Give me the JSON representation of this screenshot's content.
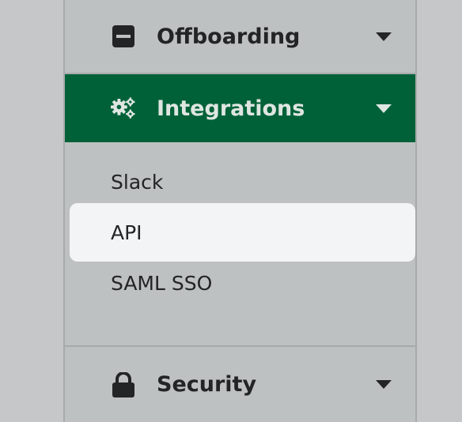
{
  "sidebar": {
    "sections": {
      "offboarding": {
        "label": "Offboarding",
        "icon": "minus-square-icon"
      },
      "integrations": {
        "label": "Integrations",
        "icon": "gears-icon",
        "items": [
          {
            "label": "Slack",
            "active": false
          },
          {
            "label": "API",
            "active": true
          },
          {
            "label": "SAML SSO",
            "active": false
          }
        ]
      },
      "security": {
        "label": "Security",
        "icon": "lock-icon"
      }
    }
  },
  "colors": {
    "integrations_header_bg": "#006138",
    "integrations_header_text": "#dfe6e2",
    "active_item_bg": "#f3f4f6",
    "text": "#222426"
  }
}
